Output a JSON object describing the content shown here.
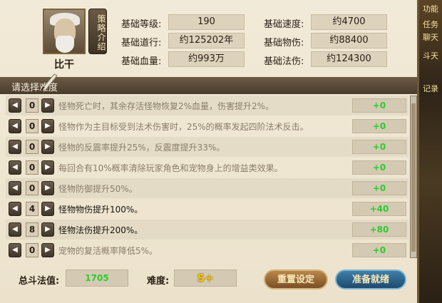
{
  "side_tabs": [
    "功能",
    "聊天",
    "斗天",
    "任务",
    "记录"
  ],
  "character": {
    "name": "比干",
    "strategy_label": "策略介绍"
  },
  "stats": {
    "base_level_label": "基础等级:",
    "base_level": "190",
    "base_speed_label": "基础速度:",
    "base_speed": "约4700",
    "base_dao_label": "基础道行:",
    "base_dao": "约125202年",
    "base_phys_label": "基础物伤:",
    "base_phys": "约88400",
    "base_hp_label": "基础血量:",
    "base_hp": "约993万",
    "base_magic_label": "基础法伤:",
    "base_magic": "约124300"
  },
  "difficulty_header": "请选择难度",
  "rows": [
    {
      "count": "0",
      "desc": "怪物死亡时，其余存活怪物恢复2%血量，伤害提升2%。",
      "bonus": "+0",
      "active": false
    },
    {
      "count": "0",
      "desc": "怪物作为主目标受到法术伤害时，25%的概率发起四阶法术反击。",
      "bonus": "+0",
      "active": false
    },
    {
      "count": "0",
      "desc": "怪物的反震率提升25%，反震度提升33%。",
      "bonus": "+0",
      "active": false
    },
    {
      "count": "0",
      "desc": "每回合有10%概率清除玩家角色和宠物身上的增益类效果。",
      "bonus": "+0",
      "active": false
    },
    {
      "count": "0",
      "desc": "怪物防御提升50%。",
      "bonus": "+0",
      "active": false
    },
    {
      "count": "4",
      "desc": "怪物物伤提升100%。",
      "bonus": "+40",
      "active": true
    },
    {
      "count": "8",
      "desc": "怪物法伤提升200%。",
      "bonus": "+80",
      "active": true
    },
    {
      "count": "0",
      "desc": "宠物的复活概率降低5%。",
      "bonus": "+0",
      "active": false
    }
  ],
  "footer": {
    "total_label": "总斗法值:",
    "total_value": "1705",
    "difficulty_label": "难度:",
    "difficulty_value": "S+",
    "reset_label": "重置设定",
    "ready_label": "准备就绪"
  },
  "colors": {
    "bonus_green": "#2ecb2e",
    "rank_gold": "#f2c200"
  }
}
